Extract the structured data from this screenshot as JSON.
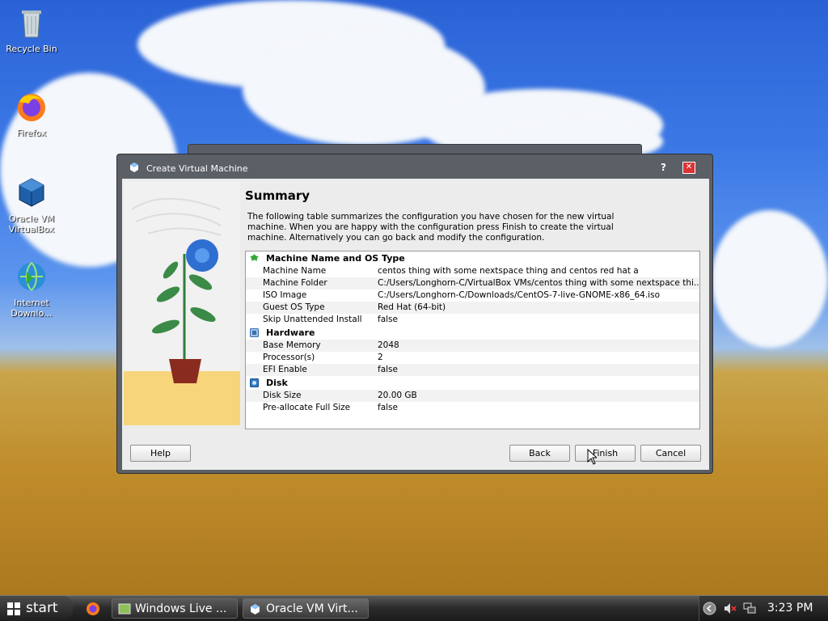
{
  "desktop": {
    "icons": [
      {
        "label": "Recycle Bin",
        "icon": "recycle-bin-icon"
      },
      {
        "label": "Firefox",
        "icon": "firefox-icon"
      },
      {
        "label": "Oracle VM VirtualBox",
        "icon": "virtualbox-icon"
      },
      {
        "label": "Internet Downlo...",
        "icon": "internet-download-manager-icon"
      }
    ]
  },
  "dialog": {
    "title": "Create Virtual Machine",
    "help_glyph": "?",
    "close_glyph": "✕",
    "heading": "Summary",
    "description": "The following table summarizes the configuration you have chosen for the new virtual machine. When you are happy with the configuration press Finish to create the virtual machine. Alternatively you can go back and modify the configuration.",
    "sections": [
      {
        "title": "Machine Name and OS Type",
        "icon": "machine-name-icon",
        "rows": [
          {
            "key": "Machine Name",
            "value": "centos thing with some nextspace thing and centos red hat a"
          },
          {
            "key": "Machine Folder",
            "value": "C:/Users/Longhorn-C/VirtualBox VMs/centos thing with some nextspace thi..."
          },
          {
            "key": "ISO Image",
            "value": "C:/Users/Longhorn-C/Downloads/CentOS-7-live-GNOME-x86_64.iso"
          },
          {
            "key": "Guest OS Type",
            "value": "Red Hat (64-bit)"
          },
          {
            "key": "Skip Unattended Install",
            "value": "false"
          }
        ]
      },
      {
        "title": "Hardware",
        "icon": "hardware-chip-icon",
        "rows": [
          {
            "key": "Base Memory",
            "value": "2048"
          },
          {
            "key": "Processor(s)",
            "value": "2"
          },
          {
            "key": "EFI Enable",
            "value": "false"
          }
        ]
      },
      {
        "title": "Disk",
        "icon": "disk-icon",
        "rows": [
          {
            "key": "Disk Size",
            "value": "20.00 GB"
          },
          {
            "key": "Pre-allocate Full Size",
            "value": "false"
          }
        ]
      }
    ],
    "buttons": {
      "help": "Help",
      "back": "Back",
      "finish": "Finish",
      "cancel": "Cancel"
    }
  },
  "taskbar": {
    "start_label": "start",
    "items": [
      {
        "label": "Windows Live ...",
        "icon": "windows-live-icon"
      },
      {
        "label": "Oracle VM Virt...",
        "icon": "virtualbox-icon"
      }
    ],
    "clock": "3:23 PM"
  },
  "colors": {
    "close_button": "#dd3333",
    "dialog_frame": "#5b5f66",
    "taskbar": "#2c2c2c"
  }
}
